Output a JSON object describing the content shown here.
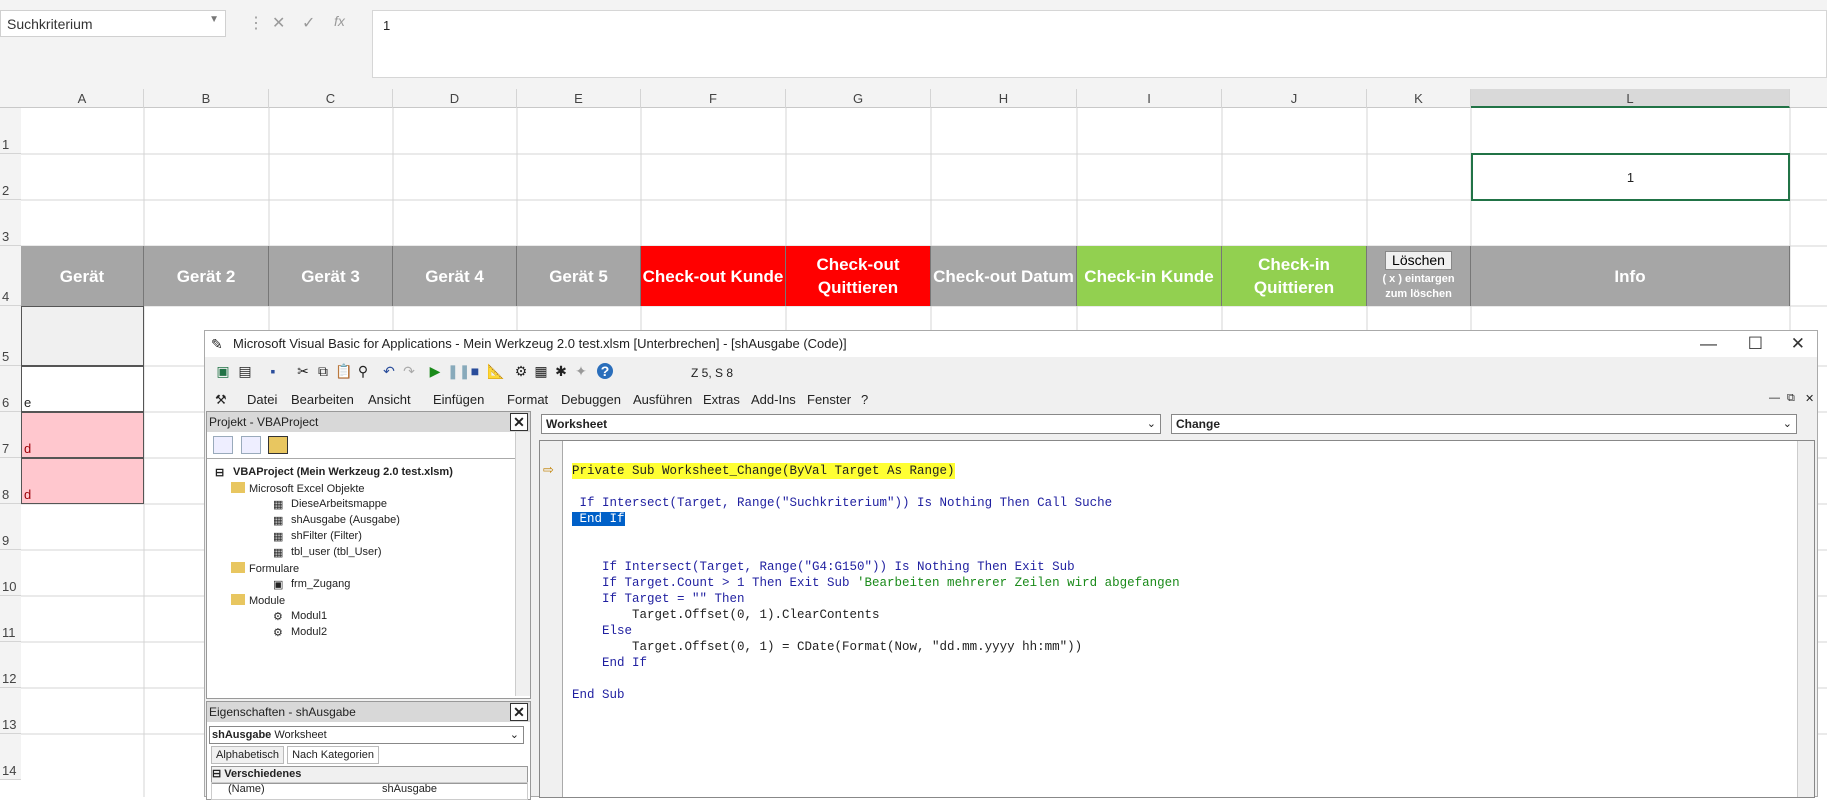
{
  "excel": {
    "name_box": "Suchkriterium",
    "formula_value": "1",
    "columns": [
      "A",
      "B",
      "C",
      "D",
      "E",
      "F",
      "G",
      "H",
      "I",
      "J",
      "K",
      "L"
    ],
    "rows": [
      "1",
      "2",
      "3",
      "4",
      "5",
      "6",
      "7",
      "8",
      "9",
      "10",
      "11",
      "12",
      "13",
      "14"
    ],
    "cell_L2": "1",
    "headers": [
      "Gerät",
      "Gerät 2",
      "Gerät 3",
      "Gerät 4",
      "Gerät 5",
      "Check-out Kunde",
      "Check-out\nQuittieren",
      "Check-out Datum",
      "Check-in Kunde",
      "Check-in\nQuittieren",
      "",
      "Info"
    ],
    "header_colors": {
      "grey": "#a6a6a6",
      "red": "#ff0000",
      "green": "#92d050"
    },
    "delete_button": "Löschen",
    "delete_hint_1": "( x ) eintargen",
    "delete_hint_2": "zum löschen",
    "cell_A6": "e",
    "cell_A7": "d",
    "cell_A8": "d"
  },
  "vba": {
    "title": "Microsoft Visual Basic for Applications - Mein Werkzeug 2.0 test.xlsm [Unterbrechen] - [shAusgabe (Code)]",
    "position": "Z 5, S 8",
    "menu": [
      "Datei",
      "Bearbeiten",
      "Ansicht",
      "Einfügen",
      "Format",
      "Debuggen",
      "Ausführen",
      "Extras",
      "Add-Ins",
      "Fenster",
      "?"
    ],
    "project_title": "Projekt - VBAProject",
    "tree": {
      "root": "VBAProject (Mein Werkzeug 2.0 test.xlsm)",
      "excel_objects": "Microsoft Excel Objekte",
      "objects": [
        "DieseArbeitsmappe",
        "shAusgabe (Ausgabe)",
        "shFilter (Filter)",
        "tbl_user (tbl_User)"
      ],
      "forms": "Formulare",
      "form_items": [
        "frm_Zugang"
      ],
      "modules": "Module",
      "module_items": [
        "Modul1",
        "Modul2"
      ]
    },
    "props_title": "Eigenschaften - shAusgabe",
    "props_object": "shAusgabe",
    "props_type": "Worksheet",
    "props_tabs": [
      "Alphabetisch",
      "Nach Kategorien"
    ],
    "props_section": "Verschiedenes",
    "props_name_key": "(Name)",
    "props_name_val": "shAusgabe",
    "object_combo": "Worksheet",
    "proc_combo": "Change",
    "code": {
      "l1": "Private Sub Worksheet_Change(ByVal Target As Range)",
      "l2": " If Intersect(Target, Range(\"Suchkriterium\")) Is Nothing Then Call Suche",
      "l3": " End If",
      "l4": "    If Intersect(Target, Range(\"G4:G150\")) Is Nothing Then Exit Sub",
      "l5": "    If Target.Count > 1 Then Exit Sub ",
      "l5c": "'Bearbeiten mehrerer Zeilen wird abgefangen",
      "l6": "    If Target = \"\" Then",
      "l7": "        Target.Offset(0, 1).ClearContents",
      "l8": "    Else",
      "l9": "        Target.Offset(0, 1) = CDate(Format(Now, \"dd.mm.yyyy hh:mm\"))",
      "l10": "    End If",
      "l11": "End Sub"
    }
  }
}
